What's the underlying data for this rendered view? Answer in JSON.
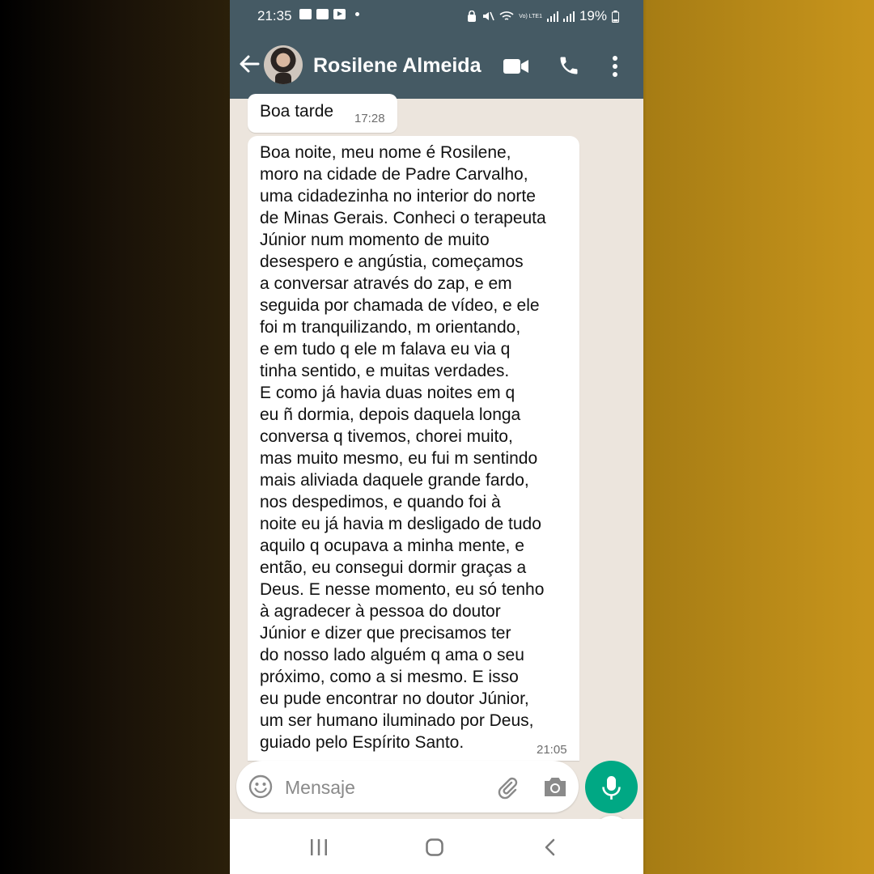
{
  "status_bar": {
    "time": "21:35",
    "battery": "19%",
    "volte": "Vo) LTE1"
  },
  "header": {
    "contact_name": "Rosilene Almeida"
  },
  "messages": [
    {
      "text": "Boa tarde",
      "time": "17:28"
    },
    {
      "text": "Boa noite, meu nome é Rosilene,\nmoro na cidade de Padre Carvalho,\numa cidadezinha no interior do norte\nde Minas Gerais. Conheci o terapeuta\nJúnior num momento de muito\ndesespero e angústia, começamos\na conversar através do zap, e em\nseguida por chamada de vídeo, e ele\nfoi m tranquilizando, m orientando,\ne em tudo q ele m falava eu via q\ntinha sentido, e muitas verdades.\nE como já havia duas noites em q\neu ñ dormia, depois daquela longa\nconversa q tivemos, chorei muito,\nmas muito mesmo, eu fui m sentindo\nmais aliviada daquele grande fardo,\nnos despedimos, e quando foi à\nnoite eu já havia m desligado de tudo\naquilo q ocupava a minha mente, e\nentão, eu consegui dormir graças a\nDeus. E nesse momento, eu só tenho\nà agradecer à pessoa do doutor\nJúnior e dizer que precisamos ter\ndo nosso lado alguém q ama o seu\npróximo, como a si mesmo. E isso\neu pude encontrar no doutor Júnior,\num ser humano iluminado por Deus,\nguiado pelo Espírito Santo.",
      "time": "21:05"
    }
  ],
  "input": {
    "placeholder": "Mensaje"
  },
  "colors": {
    "header": "#455a64",
    "chat_background": "#ece5dd",
    "bubble": "#ffffff",
    "mic_button": "#00a884"
  },
  "icons": {
    "header": [
      "back-arrow-icon",
      "video-call-icon",
      "phone-call-icon",
      "more-vert-icon"
    ],
    "input": [
      "emoji-icon",
      "attach-icon",
      "camera-icon",
      "mic-icon"
    ],
    "nav": [
      "recents-icon",
      "home-icon",
      "back-icon"
    ],
    "chat": [
      "chevron-double-down-icon"
    ]
  }
}
